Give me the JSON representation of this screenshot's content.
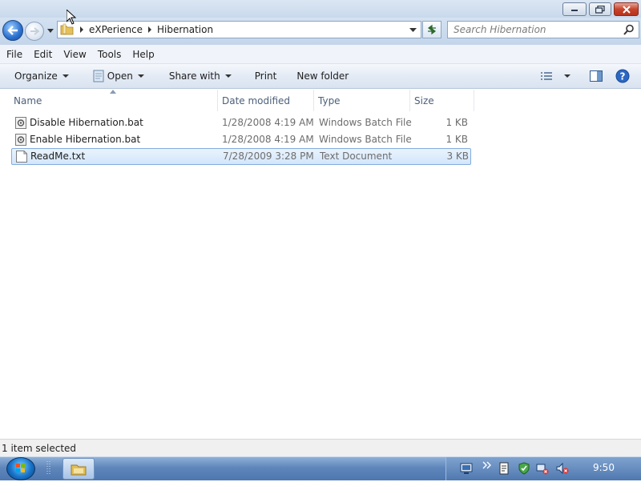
{
  "titlebar": {
    "min_icon": "minimize-icon",
    "max_icon": "maximize-icon",
    "close_icon": "close-icon"
  },
  "address": {
    "breadcrumb": [
      "eXPerience",
      "Hibernation"
    ],
    "search_placeholder": "Search Hibernation"
  },
  "menu": {
    "file": "File",
    "edit": "Edit",
    "view": "View",
    "tools": "Tools",
    "help": "Help"
  },
  "toolbar": {
    "organize": "Organize",
    "open": "Open",
    "share": "Share with",
    "print": "Print",
    "new_folder": "New folder"
  },
  "columns": {
    "name": "Name",
    "date": "Date modified",
    "type": "Type",
    "size": "Size"
  },
  "files": [
    {
      "name": "Disable Hibernation.bat",
      "date": "1/28/2008 4:19 AM",
      "type": "Windows Batch File",
      "size": "1 KB",
      "icon": "batch-file-icon"
    },
    {
      "name": "Enable Hibernation.bat",
      "date": "1/28/2008 4:19 AM",
      "type": "Windows Batch File",
      "size": "1 KB",
      "icon": "batch-file-icon"
    },
    {
      "name": "ReadMe.txt",
      "date": "7/28/2009 3:28 PM",
      "type": "Text Document",
      "size": "3 KB",
      "icon": "text-file-icon",
      "selected": true
    }
  ],
  "status": {
    "text": "1 item selected"
  },
  "taskbar": {
    "clock": "9:50"
  },
  "colors": {
    "selection": "#d2e6fb",
    "selection_border": "#84acdd",
    "taskbar": "#5f86bb"
  }
}
